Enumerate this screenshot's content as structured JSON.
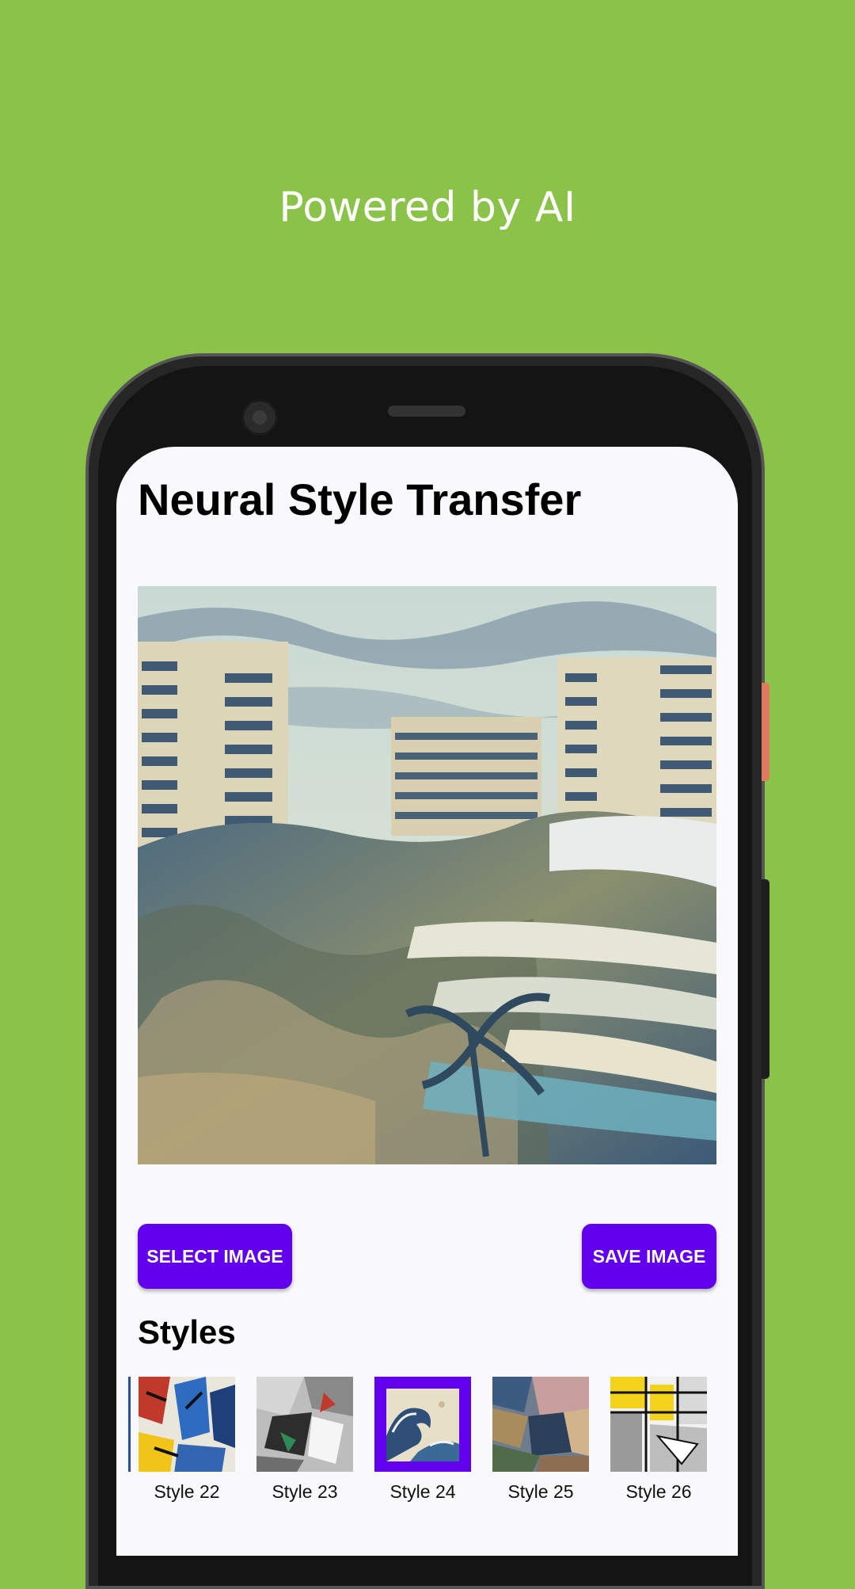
{
  "tagline": "Powered by AI",
  "app": {
    "title": "Neural Style Transfer",
    "select_button": "SELECT IMAGE",
    "save_button": "SAVE IMAGE",
    "styles_heading": "Styles"
  },
  "styles": [
    {
      "label": "Style 22",
      "selected": false
    },
    {
      "label": "Style 23",
      "selected": false
    },
    {
      "label": "Style 24",
      "selected": true
    },
    {
      "label": "Style 25",
      "selected": false
    },
    {
      "label": "Style 26",
      "selected": false
    }
  ],
  "colors": {
    "background": "#8bc34a",
    "accent": "#6200ee",
    "screen": "#f9f9fb"
  }
}
